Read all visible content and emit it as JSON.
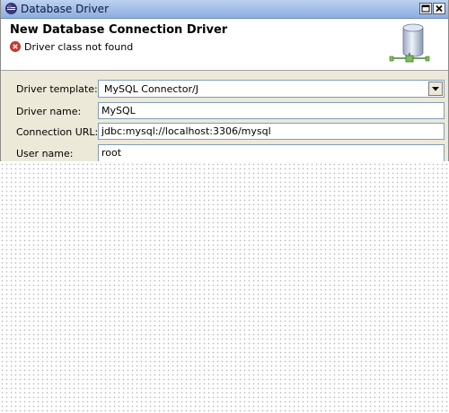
{
  "window": {
    "title": "Database Driver",
    "icon": "eclipse-icon"
  },
  "header": {
    "title": "New Database Connection Driver",
    "message": "Driver class not found",
    "message_icon": "error-icon",
    "graphic": "database-icon"
  },
  "form": {
    "driver_template": {
      "label": "Driver template:",
      "value": "MySQL Connector/J"
    },
    "driver_name": {
      "label": "Driver name:",
      "value": "MySQL"
    },
    "connection_url": {
      "label": "Connection URL:",
      "value": "jdbc:mysql://localhost:3306/mysql"
    },
    "user_name": {
      "label": "User name:",
      "value": "root"
    }
  },
  "colors": {
    "title_bar": "#a5c0e8",
    "dialog_bg": "#ece9d8",
    "error": "#d9352b"
  }
}
